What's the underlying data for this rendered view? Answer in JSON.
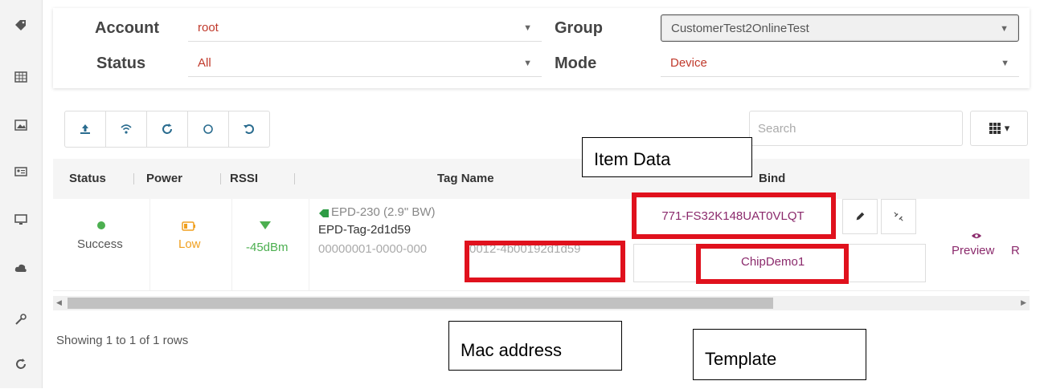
{
  "sidebar": {
    "icons": [
      "tag-icon",
      "grid-icon",
      "image-icon",
      "id-card-icon",
      "monitor-icon",
      "cloud-icon",
      "wrench-icon",
      "refresh-icon"
    ]
  },
  "filters": {
    "account_label": "Account",
    "account_value": "root",
    "status_label": "Status",
    "status_value": "All",
    "group_label": "Group",
    "group_value": "CustomerTest2OnlineTest",
    "mode_label": "Mode",
    "mode_value": "Device"
  },
  "toolbar": {
    "buttons": [
      "upload-icon",
      "wifi-icon",
      "refresh-icon",
      "circle-icon",
      "undo-icon"
    ],
    "search_placeholder": "Search"
  },
  "table": {
    "headers": {
      "status": "Status",
      "power": "Power",
      "rssi": "RSSI",
      "tag_name": "Tag Name",
      "bind": "Bind"
    },
    "row": {
      "status": "Success",
      "power": "Low",
      "rssi": "-45dBm",
      "tag_type": "EPD-230 (2.9\" BW)",
      "tag_name": "EPD-Tag-2d1d59",
      "mac_prefix": "00000001-0000-000",
      "mac_suffix": "0012-4b00192d1d59",
      "item_id": "771-FS32K148UAT0VLQT",
      "template": "ChipDemo1",
      "preview": "Preview",
      "r_partial": "R"
    }
  },
  "footer": {
    "rows_info": "Showing 1 to 1 of 1 rows"
  },
  "callouts": {
    "item_data": "Item Data",
    "mac_address": "Mac address",
    "template": "Template"
  },
  "colors": {
    "accent": "#2a6c8f",
    "success": "#4caf50",
    "warning": "#f0a020",
    "highlight": "#e0111d"
  }
}
